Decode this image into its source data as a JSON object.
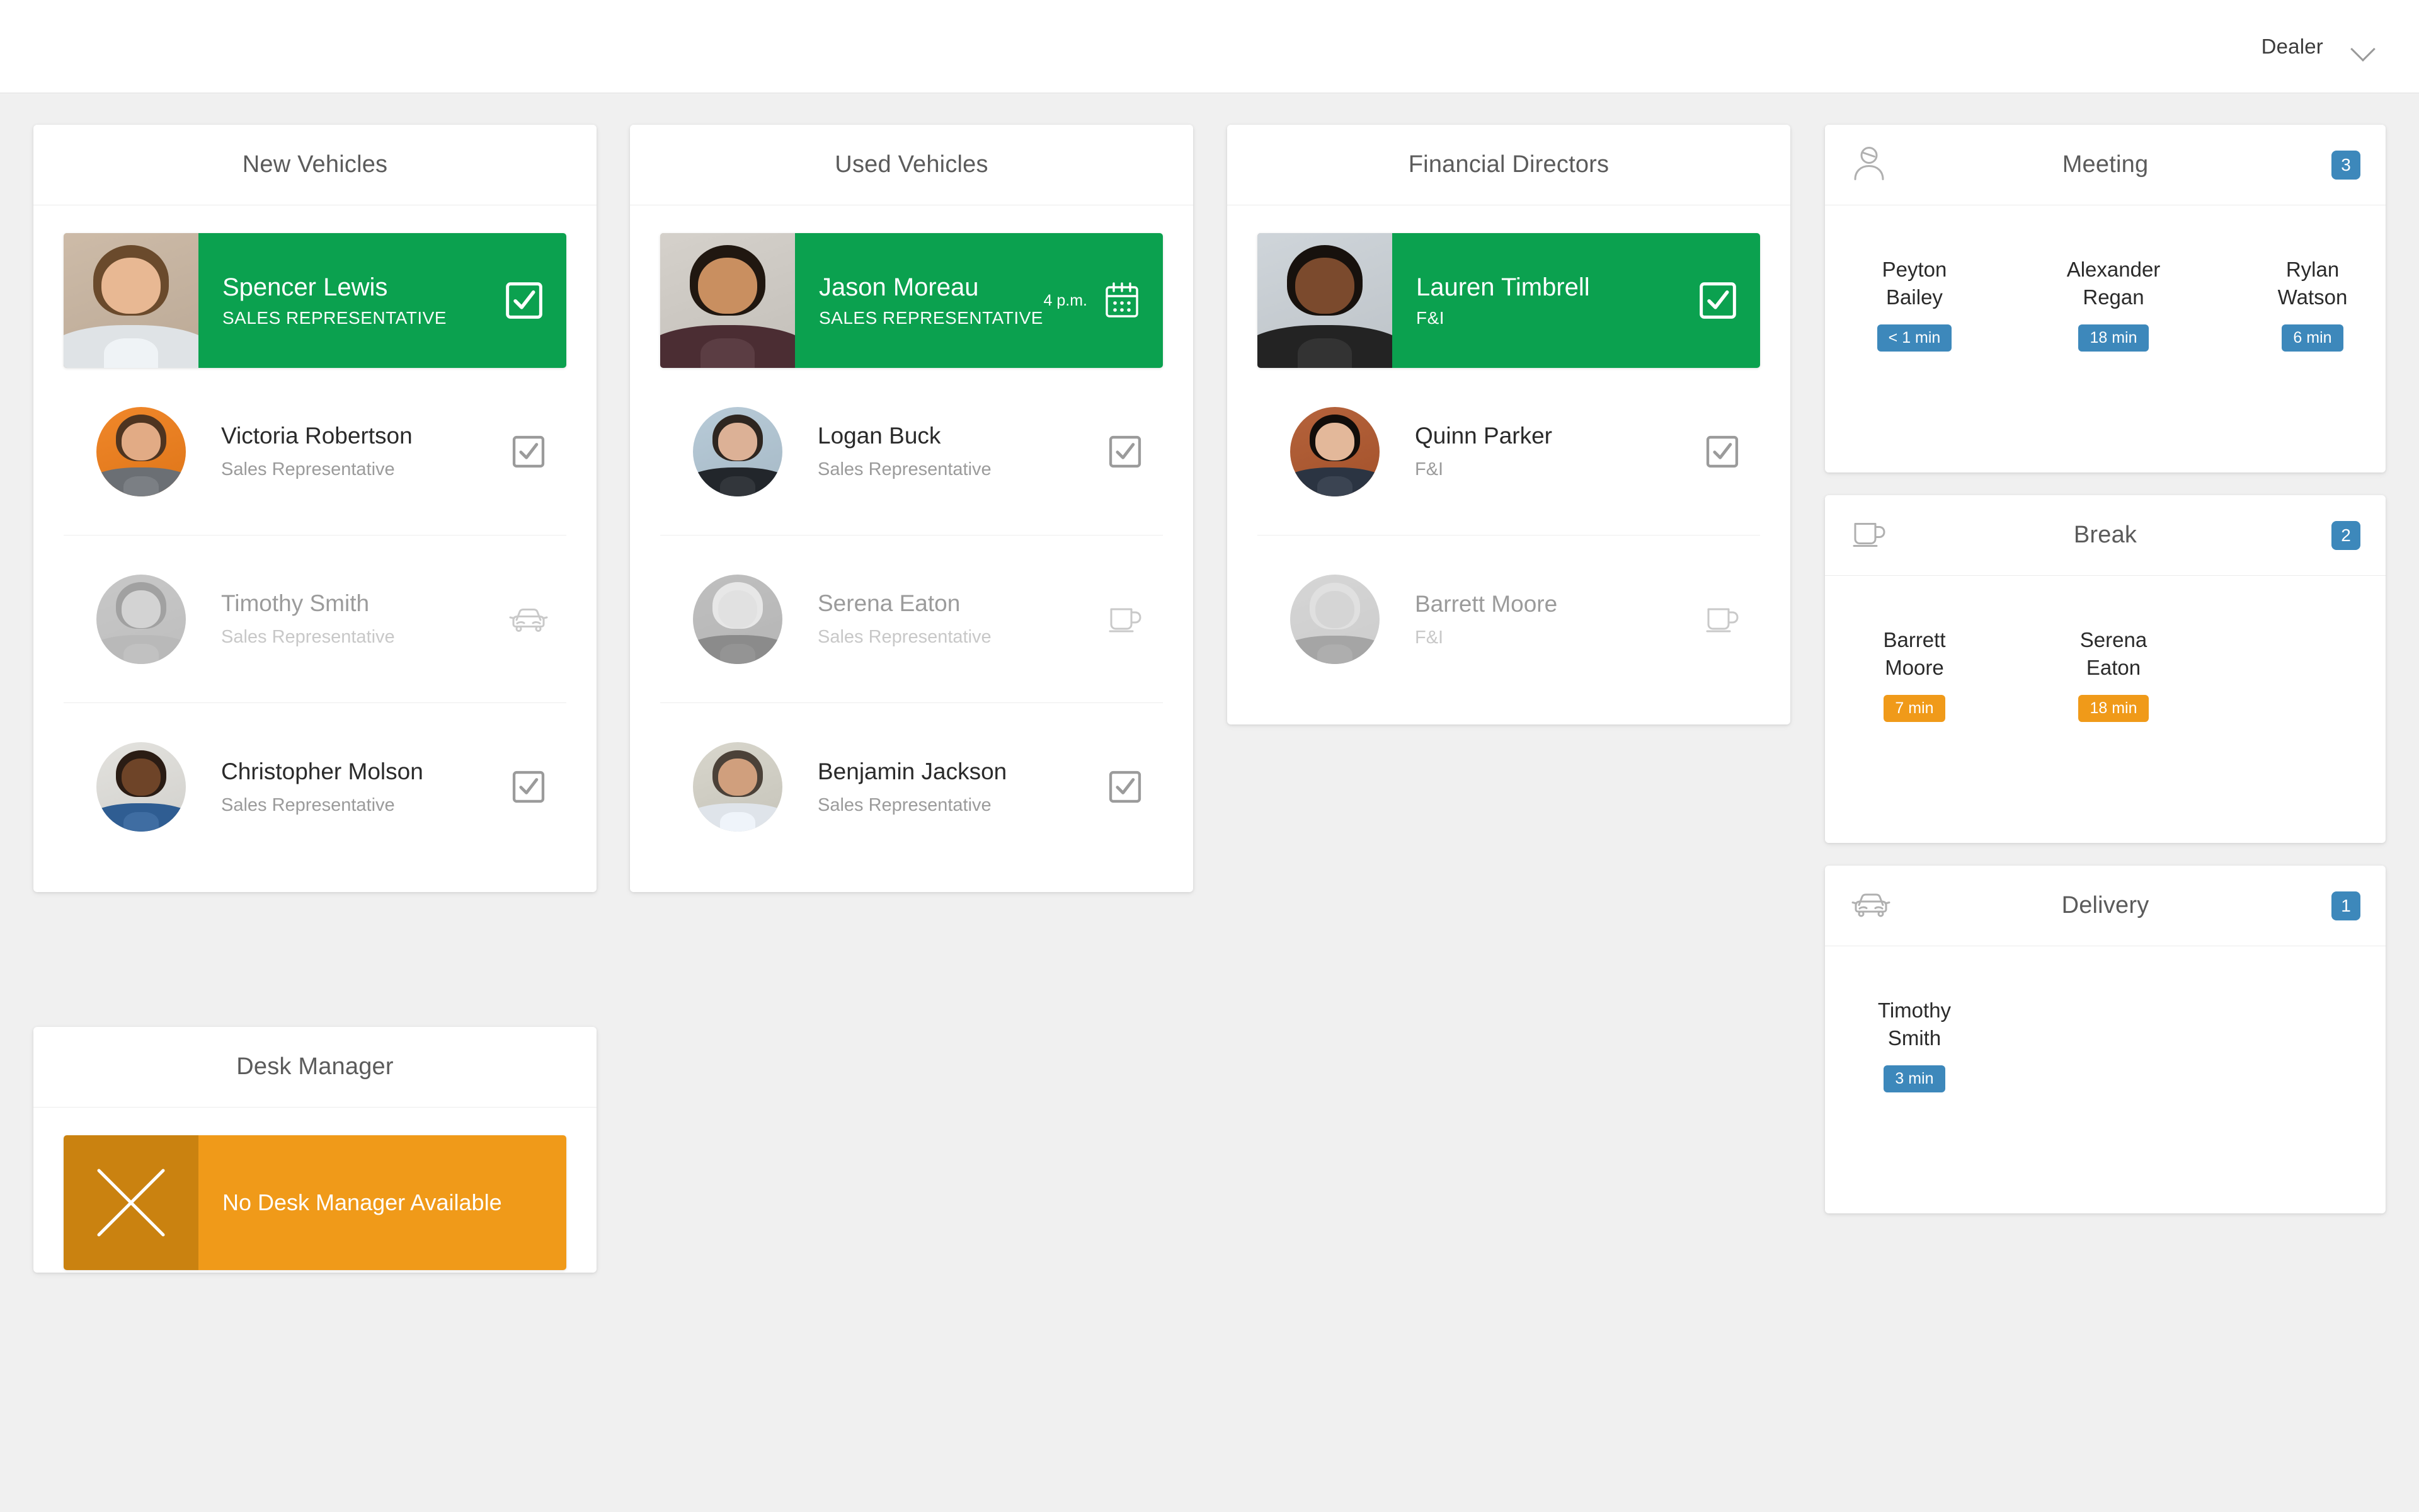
{
  "topbar": {
    "dealer_label": "Dealer",
    "chevron_icon": "chevron-down-icon"
  },
  "columns": [
    {
      "title": "New Vehicles",
      "featured": {
        "name": "Spencer Lewis",
        "role": "SALES REPRESENTATIVE",
        "status_icon": "checkbox-checked-icon",
        "time": ""
      },
      "rows": [
        {
          "name": "Victoria Robertson",
          "role": "Sales Representative",
          "icon": "checkbox-checked-icon",
          "dim": false
        },
        {
          "name": "Timothy Smith",
          "role": "Sales Representative",
          "icon": "car-icon",
          "dim": true
        },
        {
          "name": "Christopher Molson",
          "role": "Sales Representative",
          "icon": "checkbox-checked-icon",
          "dim": false
        }
      ]
    },
    {
      "title": "Used Vehicles",
      "featured": {
        "name": "Jason Moreau",
        "role": "SALES REPRESENTATIVE",
        "status_icon": "calendar-icon",
        "time": "4 p.m."
      },
      "rows": [
        {
          "name": "Logan Buck",
          "role": "Sales Representative",
          "icon": "checkbox-checked-icon",
          "dim": false
        },
        {
          "name": "Serena Eaton",
          "role": "Sales Representative",
          "icon": "coffee-cup-icon",
          "dim": true
        },
        {
          "name": "Benjamin Jackson",
          "role": "Sales Representative",
          "icon": "checkbox-checked-icon",
          "dim": false
        }
      ]
    },
    {
      "title": "Financial Directors",
      "featured": {
        "name": "Lauren Timbrell",
        "role": "F&I",
        "status_icon": "checkbox-checked-icon",
        "time": ""
      },
      "rows": [
        {
          "name": "Quinn Parker",
          "role": "F&I",
          "icon": "checkbox-checked-icon",
          "dim": false
        },
        {
          "name": "Barrett Moore",
          "role": "F&I",
          "icon": "coffee-cup-icon",
          "dim": true
        }
      ]
    }
  ],
  "desk_manager": {
    "title": "Desk Manager",
    "banner_text": "No Desk Manager Available",
    "banner_icon": "x-cross-icon"
  },
  "sidebar": {
    "panels": [
      {
        "title": "Meeting",
        "icon": "person-icon",
        "count": "3",
        "pill_color": "#3d88bb",
        "members": [
          {
            "name": "Peyton Bailey",
            "time": "< 1 min"
          },
          {
            "name": "Alexander Regan",
            "time": "18 min"
          },
          {
            "name": "Rylan Watson",
            "time": "6 min"
          }
        ]
      },
      {
        "title": "Break",
        "icon": "coffee-cup-icon",
        "count": "2",
        "pill_color": "#f09a19",
        "members": [
          {
            "name": "Barrett Moore",
            "time": "7 min"
          },
          {
            "name": "Serena Eaton",
            "time": "18 min"
          }
        ]
      },
      {
        "title": "Delivery",
        "icon": "car-icon",
        "count": "1",
        "pill_color": "#3d88bb",
        "members": [
          {
            "name": "Timothy Smith",
            "time": "3 min"
          }
        ]
      }
    ]
  },
  "colors": {
    "accent_green": "#0ba14f",
    "accent_blue": "#3d88bb",
    "accent_amber": "#f09a19",
    "page_bg": "#f0f0f0"
  }
}
